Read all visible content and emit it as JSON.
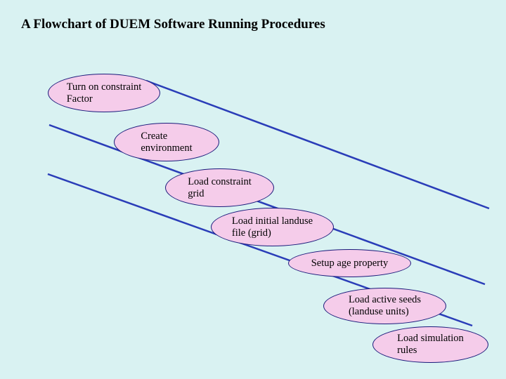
{
  "title": "A Flowchart of DUEM Software Running Procedures",
  "steps": [
    {
      "label": "Turn on constraint\nFactor"
    },
    {
      "label": "Create\nenvironment"
    },
    {
      "label": "Load constraint\ngrid"
    },
    {
      "label": "Load initial landuse\nfile (grid)"
    },
    {
      "label": "Setup age property"
    },
    {
      "label": "Load active seeds\n(landuse units)"
    },
    {
      "label": "Load simulation\nrules"
    }
  ],
  "colors": {
    "ellipseFill": "#f5ccea",
    "ellipseStroke": "#1a1a7a",
    "lineStroke": "#2a3db8",
    "background": "#d9f2f2"
  }
}
